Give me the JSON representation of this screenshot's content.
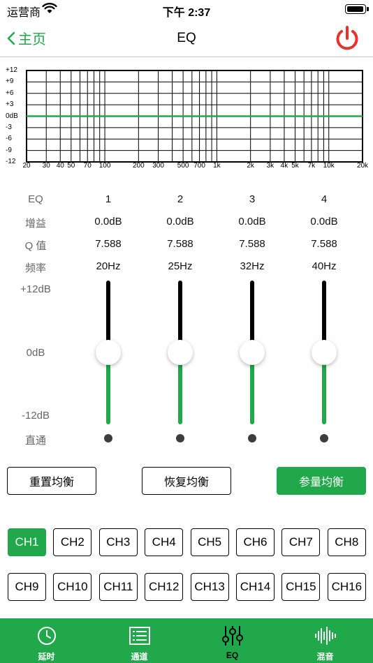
{
  "status": {
    "carrier": "运营商",
    "time": "下午 2:37",
    "battery_level": 1.0
  },
  "nav": {
    "back_label": "主页",
    "title": "EQ"
  },
  "graph": {
    "y_labels": [
      "+12",
      "+9",
      "+6",
      "+3",
      "0dB",
      "-3",
      "-6",
      "-9",
      "-12"
    ],
    "x_labels": [
      "20",
      "30",
      "40",
      "50",
      "70",
      "100",
      "200",
      "300",
      "500",
      "700",
      "1k",
      "2k",
      "3k",
      "4k",
      "5k",
      "7k",
      "10k",
      "20k"
    ],
    "curve_color": "#21a84a"
  },
  "table": {
    "labels": {
      "eq": "EQ",
      "gain": "增益",
      "q": "Q 值",
      "freq": "频率"
    },
    "bands": [
      {
        "num": "1",
        "gain": "0.0dB",
        "q": "7.588",
        "freq": "20Hz"
      },
      {
        "num": "2",
        "gain": "0.0dB",
        "q": "7.588",
        "freq": "25Hz"
      },
      {
        "num": "3",
        "gain": "0.0dB",
        "q": "7.588",
        "freq": "32Hz"
      },
      {
        "num": "4",
        "gain": "0.0dB",
        "q": "7.588",
        "freq": "40Hz"
      }
    ]
  },
  "slider_labels": {
    "max": "+12dB",
    "mid": "0dB",
    "min": "-12dB",
    "bypass": "直通"
  },
  "buttons": {
    "reset": "重置均衡",
    "restore": "恢复均衡",
    "param": "参量均衡"
  },
  "channels": [
    "CH1",
    "CH2",
    "CH3",
    "CH4",
    "CH5",
    "CH6",
    "CH7",
    "CH8",
    "CH9",
    "CH10",
    "CH11",
    "CH12",
    "CH13",
    "CH14",
    "CH15",
    "CH16"
  ],
  "active_channel": "CH1",
  "tabs": [
    {
      "label": "延时",
      "icon": "clock-icon"
    },
    {
      "label": "通道",
      "icon": "list-icon"
    },
    {
      "label": "EQ",
      "icon": "sliders-icon"
    },
    {
      "label": "混音",
      "icon": "waveform-icon"
    }
  ],
  "active_tab": "EQ",
  "colors": {
    "accent": "#21a84a",
    "power": "#e8322a"
  }
}
